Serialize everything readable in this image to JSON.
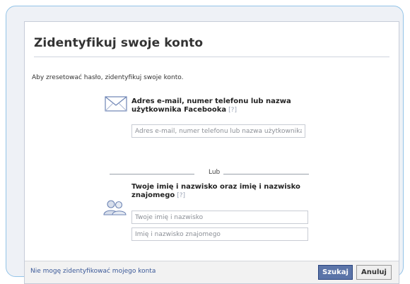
{
  "dialog": {
    "title": "Zidentyfikuj swoje konto",
    "intro": "Aby zresetować hasło, zidentyfikuj swoje konto."
  },
  "email_section": {
    "heading_line1": "Adres e-mail, numer telefonu lub nazwa",
    "heading_line2": "użytkownika Facebooka",
    "help": "[?]",
    "icon": "envelope-icon",
    "input_placeholder": "Adres e-mail, numer telefonu lub nazwa użytkownika"
  },
  "divider": {
    "label": "Lub"
  },
  "name_section": {
    "heading_line1": "Twoje imię i nazwisko oraz imię i nazwisko",
    "heading_line2": "znajomego",
    "help": "[?]",
    "icon": "people-icon",
    "own_name_placeholder": "Twoje imię i nazwisko",
    "friend_name_placeholder": "Imię i nazwisko znajomego"
  },
  "footer": {
    "link": "Nie mogę zidentyfikować mojego konta",
    "search_button": "Szukaj",
    "cancel_button": "Anuluj"
  },
  "colors": {
    "frame_border": "#93c4e8",
    "primary_button": "#5b74a8",
    "link": "#3b5998"
  }
}
